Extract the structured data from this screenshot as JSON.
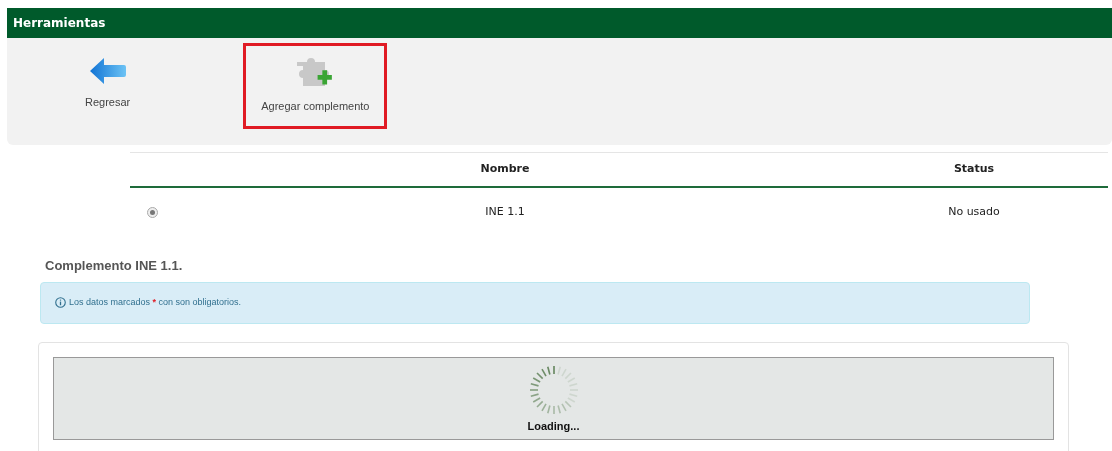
{
  "header": {
    "title": "Herramientas"
  },
  "toolbar": [
    {
      "kind": "back",
      "label": "Regresar",
      "highlighted": false
    },
    {
      "kind": "add-plugin",
      "label": "Agregar complemento",
      "highlighted": true
    }
  ],
  "table": {
    "columns": [
      "Nombre",
      "Status"
    ],
    "rows": [
      {
        "selected": true,
        "name": "INE 1.1",
        "status": "No usado"
      }
    ]
  },
  "section_title": "Complemento INE 1.1.",
  "notice": [
    {
      "kind": "text",
      "text": "Los datos marcados "
    },
    {
      "kind": "required",
      "text": "*"
    },
    {
      "kind": "text",
      "text": " con son obligatorios."
    }
  ],
  "loader": {
    "label": "Loading..."
  }
}
